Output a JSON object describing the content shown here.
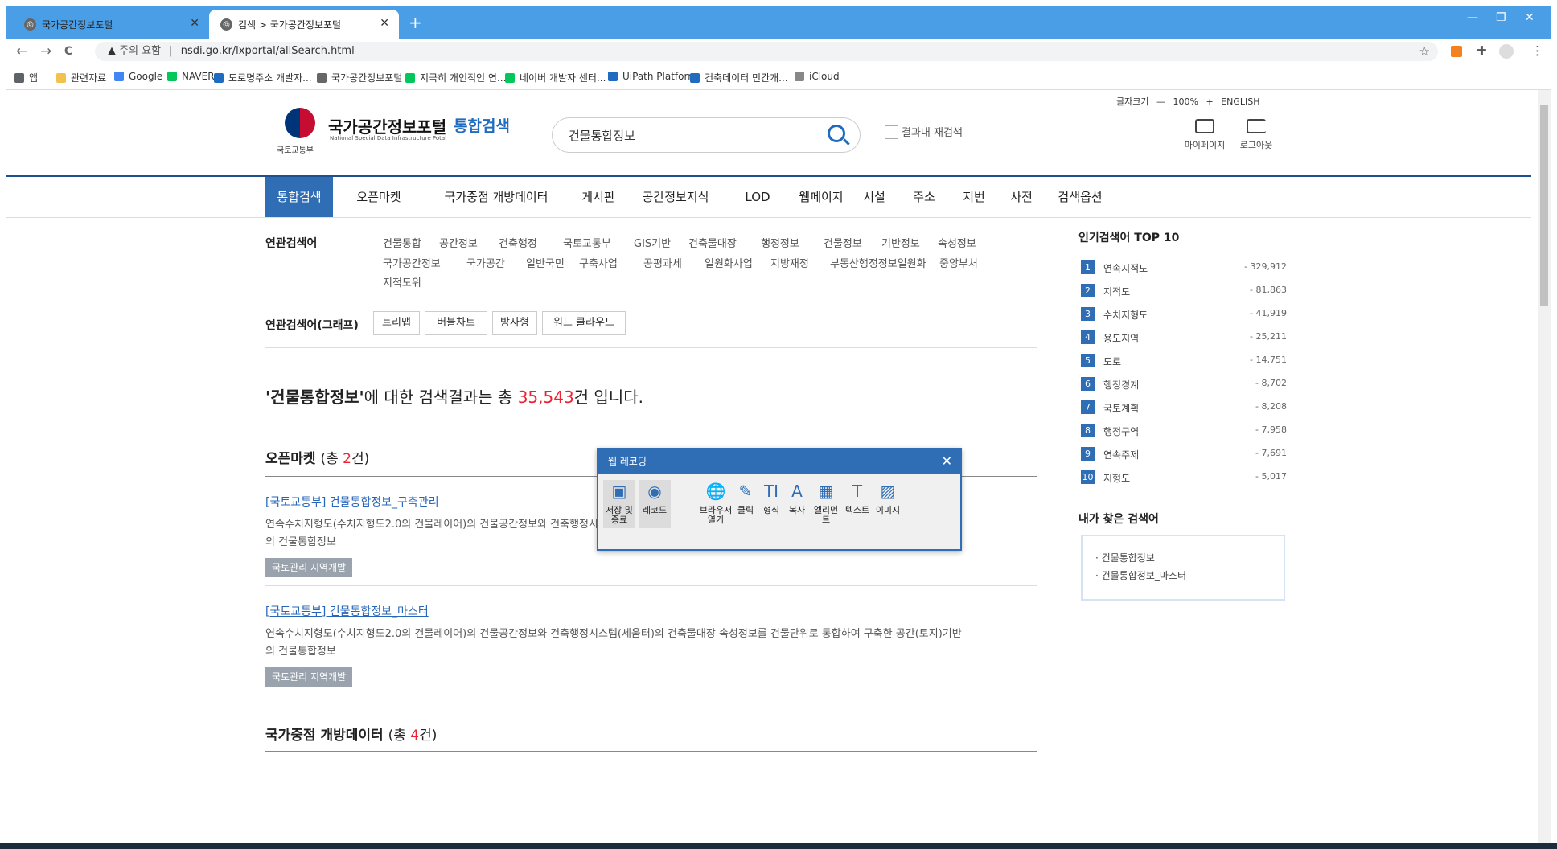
{
  "browser": {
    "tabs": [
      {
        "title": "국가공간정보포털",
        "active": false
      },
      {
        "title": "검색 > 국가공간정보포털",
        "active": true
      }
    ],
    "new_tab_label": "+",
    "window_controls": [
      "—",
      "❐",
      "✕"
    ],
    "nav": {
      "back": "←",
      "forward": "→",
      "reload": "C"
    },
    "address": {
      "warning": "주의 요함",
      "separator": "|",
      "url": "nsdi.go.kr/lxportal/allSearch.html"
    },
    "bookmarks": [
      {
        "label": "앱",
        "color": "#5f6368"
      },
      {
        "label": "관련자료",
        "color": "#f2c14e"
      },
      {
        "label": "Google",
        "color": "#4285f4"
      },
      {
        "label": "NAVER",
        "color": "#03c75a"
      },
      {
        "label": "도로명주소 개발자...",
        "color": "#1e6bbf"
      },
      {
        "label": "국가공간정보포털",
        "color": "#666666"
      },
      {
        "label": "지극히 개인적인 연...",
        "color": "#03c75a"
      },
      {
        "label": "네이버 개발자 센터...",
        "color": "#03c75a"
      },
      {
        "label": "UiPath Platform",
        "color": "#1e6bbf"
      },
      {
        "label": "건축데이터 민간개...",
        "color": "#1e6bbf"
      },
      {
        "label": "iCloud",
        "color": "#888888"
      }
    ]
  },
  "header": {
    "ministry": "국토교통부",
    "portal_title": "국가공간정보포털",
    "portal_en": "National Special Data Infrastructure Potal",
    "section_title": "통합검색",
    "search": {
      "value": "건물통합정보"
    },
    "result_recheck": "결과내 재검색",
    "font_size": {
      "label": "글자크기",
      "minus": "—",
      "value": "100%",
      "plus": "+",
      "lang": "ENGLISH"
    },
    "utils": [
      "마이페이지",
      "로그아웃"
    ]
  },
  "gnb": [
    {
      "label": "통합검색",
      "active": true
    },
    {
      "label": "오픈마켓",
      "active": false
    },
    {
      "label": "국가중점 개방데이터",
      "active": false
    },
    {
      "label": "게시판",
      "active": false
    },
    {
      "label": "공간정보지식",
      "active": false
    },
    {
      "label": "LOD",
      "active": false
    },
    {
      "label": "웹페이지",
      "active": false
    },
    {
      "label": "시설",
      "active": false
    },
    {
      "label": "주소",
      "active": false
    },
    {
      "label": "지번",
      "active": false
    },
    {
      "label": "사전",
      "active": false
    },
    {
      "label": "검색옵션",
      "active": false
    }
  ],
  "related": {
    "label": "연관검색어",
    "rows": [
      [
        "건물통합",
        "공간정보",
        "건축행정",
        "국토교통부",
        "GIS기반",
        "건축물대장",
        "행정정보",
        "건물정보",
        "기반정보",
        "속성정보"
      ],
      [
        "국가공간정보",
        "국가공간",
        "일반국민",
        "구축사업",
        "공평과세",
        "일원화사업",
        "지방재정",
        "부동산행정정보일원화",
        "중앙부처"
      ],
      [
        "지적도위"
      ]
    ],
    "graph_label": "연관검색어(그래프)",
    "graph_buttons": [
      "트리맵",
      "버블차트",
      "방사형",
      "워드 클라우드"
    ]
  },
  "summary": {
    "query": "'건물통합정보'",
    "mid": "에 대한 검색결과는 총 ",
    "count": "35,543",
    "tail": "건 입니다."
  },
  "open_market": {
    "title": "오픈마켓",
    "count_prefix": "(총 ",
    "count": "2",
    "count_suffix": "건)",
    "results": [
      {
        "title": "[국토교통부] 건물통합정보_구축관리",
        "desc_line1": "연속수치지형도(수치지형도2.0의 건물레이어)의 건물공간정보와 건축행정시스템(세움터)의 건축물대장 속성정보를 건물단위로 통합하여 구축한 공간(토지)기반",
        "desc_line2": "의 건물통합정보",
        "tag": "국토관리 지역개발"
      },
      {
        "title": "[국토교통부] 건물통합정보_마스터",
        "desc_line1": "연속수치지형도(수치지형도2.0의 건물레이어)의 건물공간정보와 건축행정시스템(세움터)의 건축물대장 속성정보를 건물단위로 통합하여 구축한 공간(토지)기반",
        "desc_line2": "의 건물통합정보",
        "tag": "국토관리 지역개발"
      }
    ]
  },
  "open_data": {
    "title": "국가중점 개방데이터",
    "count_prefix": "(총 ",
    "count": "4",
    "count_suffix": "건)"
  },
  "popular": {
    "title": "인기검색어 TOP 10",
    "items": [
      {
        "rank": "1",
        "keyword": "연속지적도",
        "count": "- 329,912"
      },
      {
        "rank": "2",
        "keyword": "지적도",
        "count": "- 81,863"
      },
      {
        "rank": "3",
        "keyword": "수치지형도",
        "count": "- 41,919"
      },
      {
        "rank": "4",
        "keyword": "용도지역",
        "count": "- 25,211"
      },
      {
        "rank": "5",
        "keyword": "도로",
        "count": "- 14,751"
      },
      {
        "rank": "6",
        "keyword": "행정경계",
        "count": "- 8,702"
      },
      {
        "rank": "7",
        "keyword": "국토계획",
        "count": "- 8,208"
      },
      {
        "rank": "8",
        "keyword": "행정구역",
        "count": "- 7,958"
      },
      {
        "rank": "9",
        "keyword": "연속주제",
        "count": "- 7,691"
      },
      {
        "rank": "10",
        "keyword": "지형도",
        "count": "- 5,017"
      }
    ]
  },
  "my_searches": {
    "title": "내가 찾은 검색어",
    "items": [
      "· 건물통합정보",
      "· 건물통합정보_마스터"
    ]
  },
  "recorder": {
    "title": "웹 레코딩",
    "close": "✕",
    "buttons": [
      {
        "label": "저장 및 종료",
        "icon": "save-icon",
        "glyph": "▣"
      },
      {
        "label": "레코드",
        "icon": "record-icon",
        "glyph": "◉"
      },
      {
        "label": "브라우저 열기",
        "icon": "globe-icon",
        "glyph": "🌐"
      },
      {
        "label": "클릭",
        "icon": "click-icon",
        "glyph": "✎"
      },
      {
        "label": "형식",
        "icon": "type-icon",
        "glyph": "TI"
      },
      {
        "label": "복사",
        "icon": "copy-icon",
        "glyph": "A"
      },
      {
        "label": "엘리먼트",
        "icon": "element-icon",
        "glyph": "▦"
      },
      {
        "label": "텍스트",
        "icon": "text-icon",
        "glyph": "T"
      },
      {
        "label": "이미지",
        "icon": "image-icon",
        "glyph": "▨"
      }
    ]
  },
  "colors": {
    "accent": "#2f6db5",
    "highlight": "#e22233",
    "tabbar": "#4a9ee6"
  }
}
